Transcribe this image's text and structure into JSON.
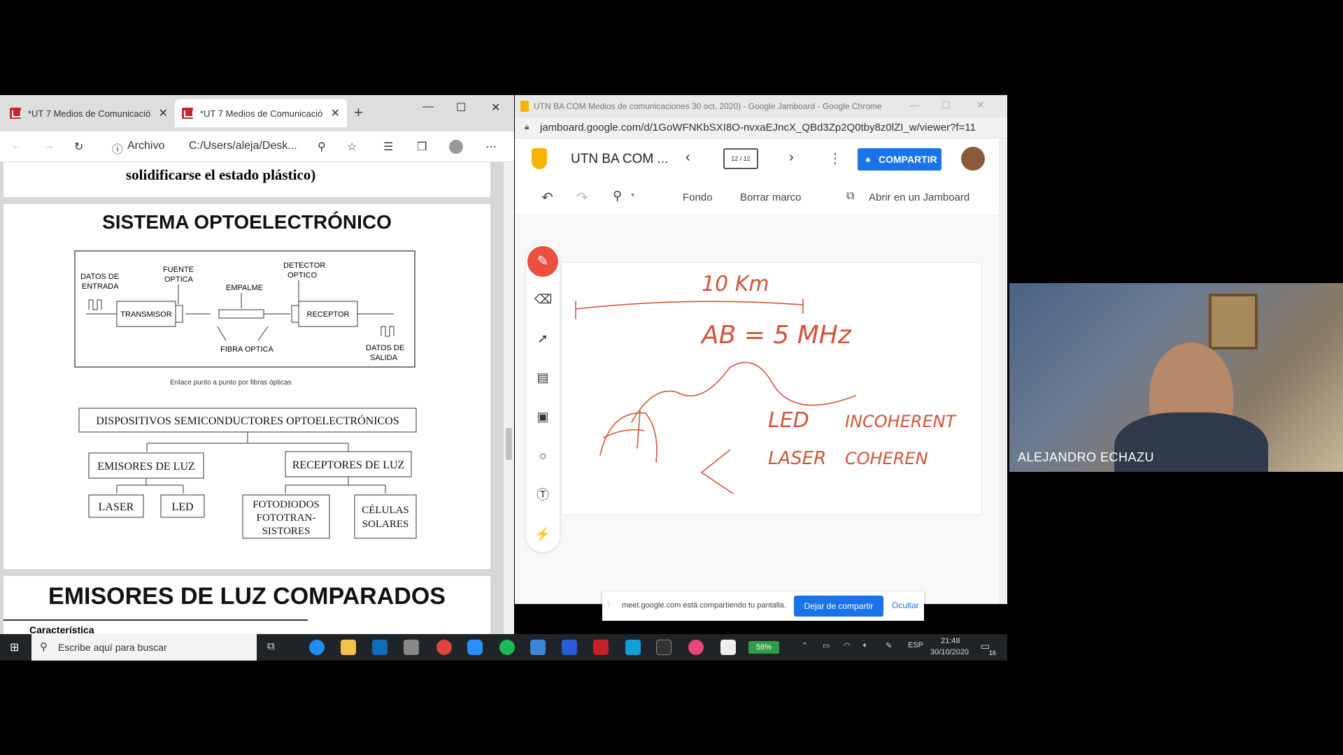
{
  "edge": {
    "tabs": [
      {
        "label": "*UT 7 Medios de Comunicació"
      },
      {
        "label": "*UT 7 Medios de Comunicació"
      }
    ],
    "address": {
      "info_label": "Archivo",
      "path": "C:/Users/aleja/Desk..."
    },
    "pdf": {
      "prev_page_tail": "solidificarse el estado plástico)",
      "section1_title": "SISTEMA OPTOELECTRÓNICO",
      "diagram": {
        "datos_entrada": [
          "DATOS DE",
          "ENTRADA"
        ],
        "fuente": [
          "FUENTE",
          "OPTICA"
        ],
        "empalme": "EMPALME",
        "detector": [
          "DETECTOR",
          "OPTICO"
        ],
        "transmisor": "TRANSMISOR",
        "receptor": "RECEPTOR",
        "fibra": "FIBRA OPTICA",
        "datos_salida": [
          "DATOS DE",
          "SALIDA"
        ],
        "caption": "Enlace punto a punto por fibras ópticas"
      },
      "tree": {
        "root": "DISPOSITIVOS SEMICONDUCTORES OPTOELECTRÓNICOS",
        "emisores": "EMISORES DE LUZ",
        "receptores": "RECEPTORES DE LUZ",
        "laser": "LASER",
        "led": "LED",
        "foto": [
          "FOTODIODOS",
          "FOTOTRAN-",
          "SISTORES"
        ],
        "celulas": [
          "CÉLULAS",
          "SOLARES"
        ]
      },
      "section2_title": "EMISORES DE LUZ COMPARADOS",
      "table_header": "Característica"
    }
  },
  "chrome": {
    "window_title": "UTN BA COM Medios de comunicaciones 30 oct. 2020) - Google Jamboard - Google Chrome",
    "url": "jamboard.google.com/d/1GoWFNKbSXI8O-nvxaEJncX_QBd3Zp2Q0tby8z0lZI_w/viewer?f=11",
    "jam_title": "UTN BA COM ...",
    "frame_counter": "12 / 12",
    "share_label": "COMPARTIR",
    "toolbar": {
      "fondo": "Fondo",
      "borrar": "Borrar marco",
      "abrir": "Abrir en un Jamboard"
    },
    "handwriting": {
      "distance": "10 Km",
      "bandwidth": "AB = 5 MHz",
      "led": "LED",
      "incoherent": "INCOHERENT",
      "laser": "LASER",
      "coherent": "COHEREN"
    },
    "pen_color": "#d2553a"
  },
  "sharebar": {
    "message": "meet.google.com está compartiendo tu pantalla.",
    "stop_label": "Dejar de compartir",
    "hide_label": "Ocultar"
  },
  "video": {
    "participant_name": "ALEJANDRO ECHAZU"
  },
  "taskbar": {
    "search_placeholder": "Escribe aquí para buscar",
    "battery": "58%",
    "language": "ESP",
    "time": "21:48",
    "date": "30/10/2020",
    "notification_count": "16"
  }
}
